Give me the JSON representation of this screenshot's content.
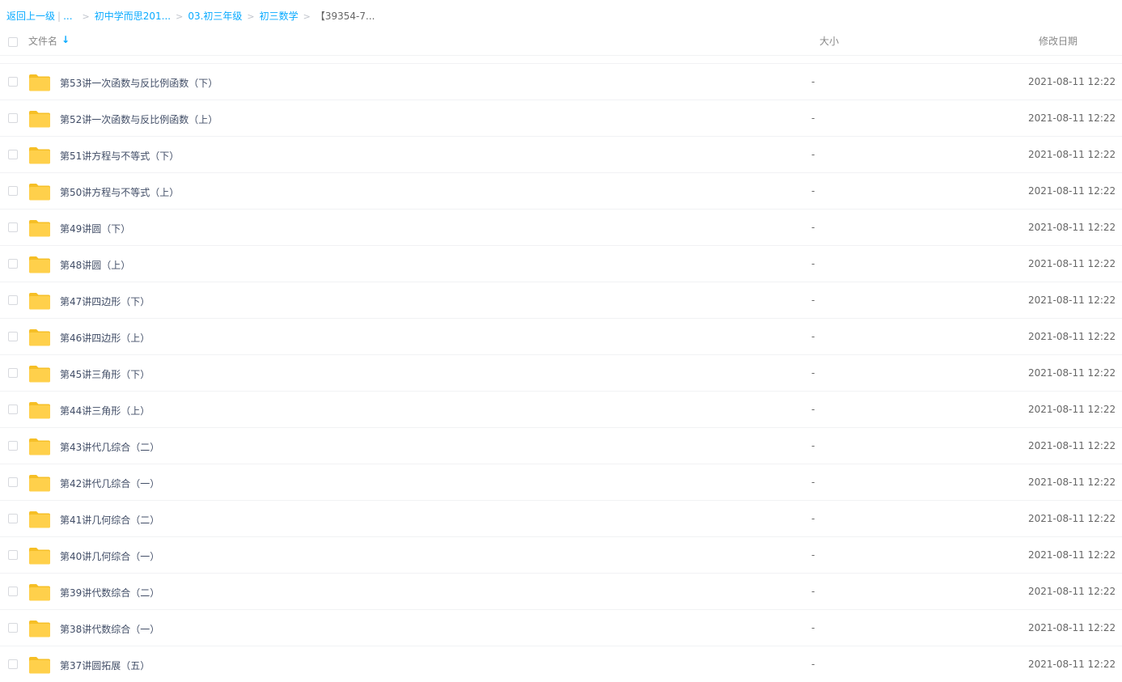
{
  "breadcrumb": {
    "back_label": "返回上一级",
    "separator": "|",
    "ellipsis": "...",
    "items": [
      "初中学而思201...",
      "03.初三年级",
      "初三数学"
    ],
    "current": "【39354-7..."
  },
  "header": {
    "name_label": "文件名",
    "sort_icon": "arrow-down-icon",
    "size_label": "大小",
    "date_label": "修改日期"
  },
  "colors": {
    "link": "#09aaff",
    "folder": "#ffd04b",
    "folder_tab": "#f6bf26",
    "text": "#424e67"
  },
  "files": [
    {
      "name": "第53讲一次函数与反比例函数（下）",
      "size": "-",
      "date": "2021-08-11 12:22",
      "icon": "folder-icon"
    },
    {
      "name": "第52讲一次函数与反比例函数（上）",
      "size": "-",
      "date": "2021-08-11 12:22",
      "icon": "folder-icon"
    },
    {
      "name": "第51讲方程与不等式（下）",
      "size": "-",
      "date": "2021-08-11 12:22",
      "icon": "folder-icon"
    },
    {
      "name": "第50讲方程与不等式（上）",
      "size": "-",
      "date": "2021-08-11 12:22",
      "icon": "folder-icon"
    },
    {
      "name": "第49讲圆（下）",
      "size": "-",
      "date": "2021-08-11 12:22",
      "icon": "folder-icon"
    },
    {
      "name": "第48讲圆（上）",
      "size": "-",
      "date": "2021-08-11 12:22",
      "icon": "folder-icon"
    },
    {
      "name": "第47讲四边形（下）",
      "size": "-",
      "date": "2021-08-11 12:22",
      "icon": "folder-icon"
    },
    {
      "name": "第46讲四边形（上）",
      "size": "-",
      "date": "2021-08-11 12:22",
      "icon": "folder-icon"
    },
    {
      "name": "第45讲三角形（下）",
      "size": "-",
      "date": "2021-08-11 12:22",
      "icon": "folder-icon"
    },
    {
      "name": "第44讲三角形（上）",
      "size": "-",
      "date": "2021-08-11 12:22",
      "icon": "folder-icon"
    },
    {
      "name": "第43讲代几综合（二）",
      "size": "-",
      "date": "2021-08-11 12:22",
      "icon": "folder-icon"
    },
    {
      "name": "第42讲代几综合（一）",
      "size": "-",
      "date": "2021-08-11 12:22",
      "icon": "folder-icon"
    },
    {
      "name": "第41讲几何综合（二）",
      "size": "-",
      "date": "2021-08-11 12:22",
      "icon": "folder-icon"
    },
    {
      "name": "第40讲几何综合（一）",
      "size": "-",
      "date": "2021-08-11 12:22",
      "icon": "folder-icon"
    },
    {
      "name": "第39讲代数综合（二）",
      "size": "-",
      "date": "2021-08-11 12:22",
      "icon": "folder-icon"
    },
    {
      "name": "第38讲代数综合（一）",
      "size": "-",
      "date": "2021-08-11 12:22",
      "icon": "folder-icon"
    },
    {
      "name": "第37讲圆拓展（五）",
      "size": "-",
      "date": "2021-08-11 12:22",
      "icon": "folder-icon"
    }
  ]
}
